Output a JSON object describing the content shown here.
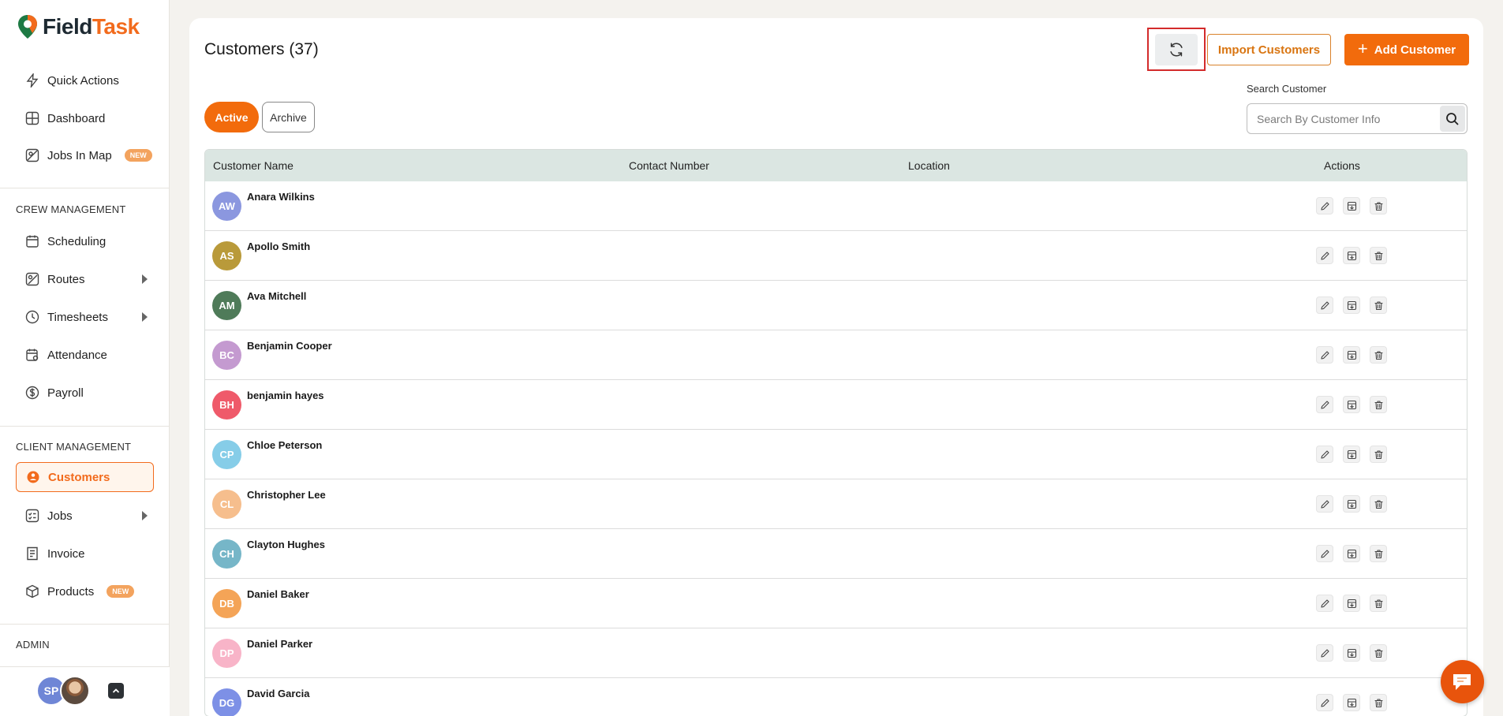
{
  "brand": {
    "name_part1": "Field",
    "name_part2": "Task"
  },
  "colors": {
    "accent": "#f26b0c",
    "sidebar_active_bg": "#fff5ec",
    "table_header_bg": "#dbe6e2",
    "highlight_box": "#d32b2b"
  },
  "sidebar": {
    "top_items": [
      {
        "label": "Quick Actions",
        "icon": "lightning-icon"
      },
      {
        "label": "Dashboard",
        "icon": "dashboard-grid-icon"
      },
      {
        "label": "Jobs In Map",
        "icon": "map-icon",
        "badge": "NEW"
      }
    ],
    "crew_section": {
      "title": "CREW MANAGEMENT",
      "items": [
        {
          "label": "Scheduling",
          "icon": "calendar-icon"
        },
        {
          "label": "Routes",
          "icon": "route-map-icon",
          "expandable": true
        },
        {
          "label": "Timesheets",
          "icon": "clock-icon",
          "expandable": true
        },
        {
          "label": "Attendance",
          "icon": "attendance-calendar-icon"
        },
        {
          "label": "Payroll",
          "icon": "dollar-coin-icon"
        }
      ]
    },
    "client_section": {
      "title": "CLIENT MANAGEMENT",
      "items": [
        {
          "label": "Customers",
          "icon": "customers-icon",
          "active": true
        },
        {
          "label": "Jobs",
          "icon": "jobs-list-icon",
          "expandable": true
        },
        {
          "label": "Invoice",
          "icon": "invoice-icon"
        },
        {
          "label": "Products",
          "icon": "product-box-icon",
          "badge": "NEW"
        }
      ]
    },
    "admin_section": {
      "title": "ADMIN"
    },
    "user": {
      "initials": "SP"
    }
  },
  "header": {
    "title": "Customers (37)",
    "import_label": "Import Customers",
    "add_label": "Add Customer",
    "add_icon": "+"
  },
  "filters": {
    "active_label": "Active",
    "archive_label": "Archive"
  },
  "search": {
    "label": "Search Customer",
    "placeholder": "Search By Customer Info"
  },
  "table": {
    "columns": [
      "Customer Name",
      "Contact Number",
      "Location",
      "Actions"
    ],
    "rows": [
      {
        "initials": "AW",
        "name": "Anara Wilkins",
        "color": "#8b97df"
      },
      {
        "initials": "AS",
        "name": "Apollo Smith",
        "color": "#b99a3a"
      },
      {
        "initials": "AM",
        "name": "Ava Mitchell",
        "color": "#4f7b59"
      },
      {
        "initials": "BC",
        "name": "Benjamin Cooper",
        "color": "#c49ad0"
      },
      {
        "initials": "BH",
        "name": "benjamin hayes",
        "color": "#ef5a6a"
      },
      {
        "initials": "CP",
        "name": "Chloe Peterson",
        "color": "#86cde8"
      },
      {
        "initials": "CL",
        "name": "Christopher Lee",
        "color": "#f6be8d"
      },
      {
        "initials": "CH",
        "name": "Clayton Hughes",
        "color": "#76b6c8"
      },
      {
        "initials": "DB",
        "name": "Daniel Baker",
        "color": "#f4a457"
      },
      {
        "initials": "DP",
        "name": "Daniel Parker",
        "color": "#f8b4c8"
      },
      {
        "initials": "DG",
        "name": "David Garcia",
        "color": "#7d90e6"
      }
    ]
  }
}
